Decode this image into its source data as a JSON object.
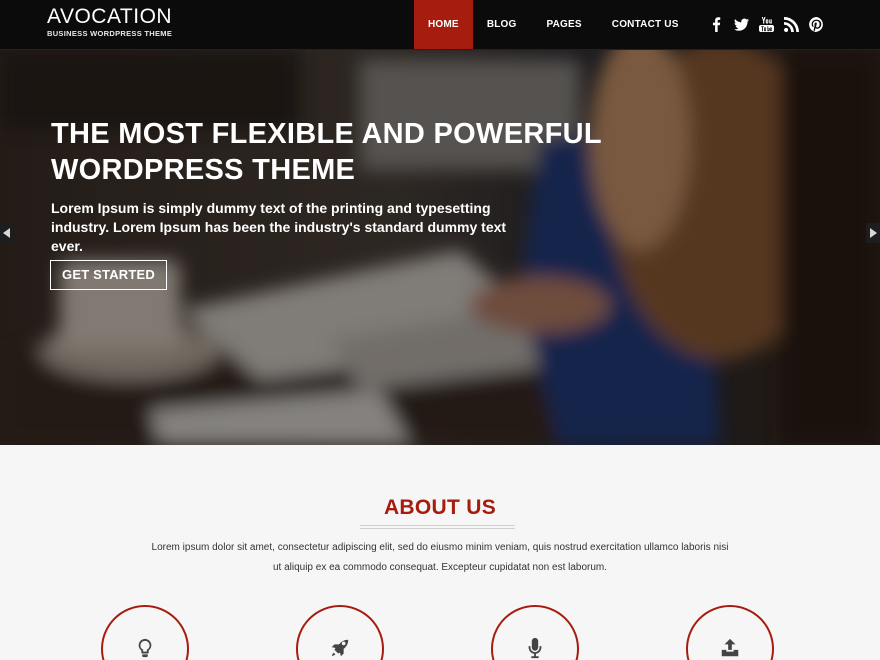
{
  "header": {
    "logo_title": "AVOCATION",
    "logo_tagline": "BUSINESS WORDPRESS THEME",
    "nav": [
      {
        "label": "HOME",
        "active": true
      },
      {
        "label": "BLOG",
        "active": false
      },
      {
        "label": "PAGES",
        "active": false
      },
      {
        "label": "CONTACT US",
        "active": false
      }
    ],
    "social": [
      "facebook-icon",
      "twitter-icon",
      "youtube-icon",
      "rss-icon",
      "pinterest-icon"
    ]
  },
  "hero": {
    "title": "THE MOST FLEXIBLE AND POWERFUL WORDPRESS THEME",
    "subtitle": "Lorem Ipsum is simply dummy text of the printing and typesetting industry. Lorem Ipsum has been the industry's standard dummy text ever.",
    "button_label": "GET STARTED"
  },
  "about": {
    "title": "ABOUT US",
    "text": "Lorem ipsum dolor sit amet, consectetur adipiscing elit, sed do eiusmo minim veniam, quis nostrud exercitation ullamco laboris nisi ut aliquip ex ea commodo consequat. Excepteur cupidatat non est laborum.",
    "features": [
      "lightbulb-icon",
      "rocket-icon",
      "microphone-icon",
      "upload-icon"
    ]
  },
  "colors": {
    "accent": "#a61c0e",
    "header_bg": "#0b0b0b",
    "section_bg": "#f6f6f6"
  }
}
